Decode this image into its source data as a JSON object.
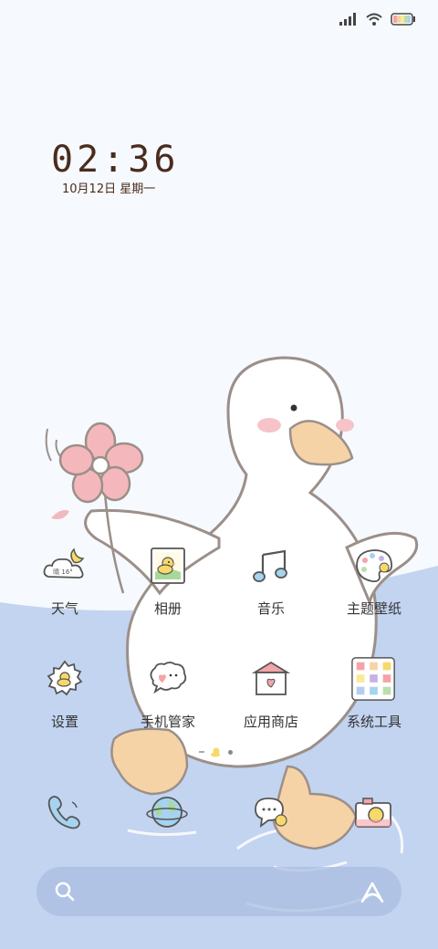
{
  "status_bar": {
    "signal_icon": "signal-bars-icon",
    "wifi_icon": "wifi-icon",
    "battery_icon": "battery-icon"
  },
  "lock": {
    "time": "02:36",
    "date": "10月12日 星期一"
  },
  "apps": [
    {
      "label": "天气",
      "icon": "weather-icon",
      "weather_text": "晴 16°"
    },
    {
      "label": "相册",
      "icon": "gallery-icon"
    },
    {
      "label": "音乐",
      "icon": "music-note-icon"
    },
    {
      "label": "主题壁纸",
      "icon": "palette-icon"
    },
    {
      "label": "设置",
      "icon": "gear-icon"
    },
    {
      "label": "手机管家",
      "icon": "chat-heart-icon"
    },
    {
      "label": "应用商店",
      "icon": "store-icon"
    },
    {
      "label": "系统工具",
      "icon": "tools-folder-icon"
    }
  ],
  "dock": [
    {
      "name": "phone",
      "icon": "phone-icon"
    },
    {
      "name": "browser",
      "icon": "globe-icon"
    },
    {
      "name": "messages",
      "icon": "message-icon"
    },
    {
      "name": "camera",
      "icon": "camera-icon"
    }
  ],
  "search": {
    "search_icon": "search-icon",
    "assistant_icon": "assistant-icon"
  },
  "colors": {
    "sky": "#f6f9fd",
    "water": "#c2d4f0",
    "clock_text": "#4a2c1d",
    "duck_beak": "#f6d3a6",
    "flower": "#f4b8bc"
  }
}
